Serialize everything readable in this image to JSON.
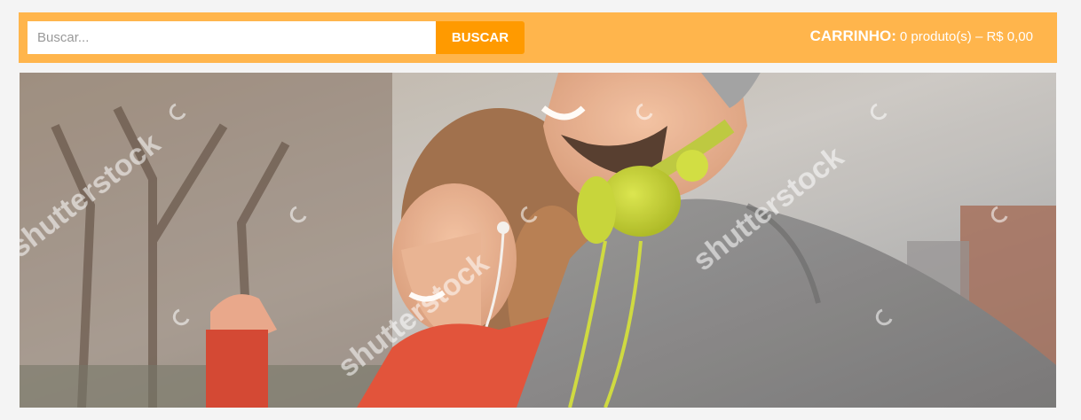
{
  "search": {
    "placeholder": "Buscar...",
    "value": "",
    "button_label": "BUSCAR"
  },
  "cart": {
    "label": "CARRINHO:",
    "info": "0 produto(s) – R$ 0,00"
  },
  "banner": {
    "watermark": "shutterstock"
  },
  "colors": {
    "header_bg": "#ffb54c",
    "button_bg": "#ff9a00",
    "page_bg": "#f4f4f4"
  }
}
